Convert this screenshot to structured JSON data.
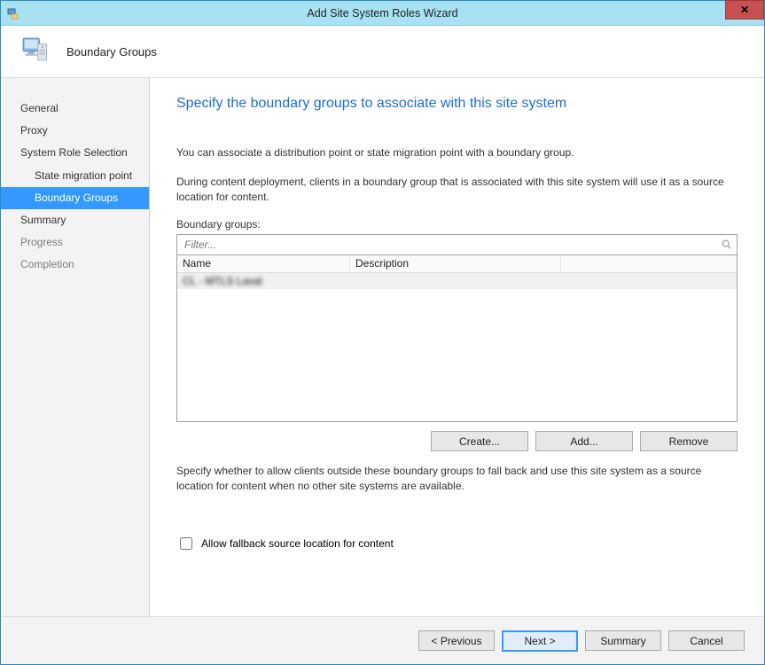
{
  "window": {
    "title": "Add Site System Roles Wizard"
  },
  "banner": {
    "title": "Boundary Groups"
  },
  "nav": {
    "items": [
      {
        "label": "General",
        "indent": false,
        "selected": false,
        "disabled": false
      },
      {
        "label": "Proxy",
        "indent": false,
        "selected": false,
        "disabled": false
      },
      {
        "label": "System Role Selection",
        "indent": false,
        "selected": false,
        "disabled": false
      },
      {
        "label": "State migration point",
        "indent": true,
        "selected": false,
        "disabled": false
      },
      {
        "label": "Boundary Groups",
        "indent": true,
        "selected": true,
        "disabled": false
      },
      {
        "label": "Summary",
        "indent": false,
        "selected": false,
        "disabled": false
      },
      {
        "label": "Progress",
        "indent": false,
        "selected": false,
        "disabled": true
      },
      {
        "label": "Completion",
        "indent": false,
        "selected": false,
        "disabled": true
      }
    ]
  },
  "content": {
    "heading": "Specify the boundary groups to associate with this site system",
    "para1": "You can associate a distribution point or state migration point with a boundary group.",
    "para2": "During content deployment, clients in a boundary group that is associated with this site system will use it as a source location for content.",
    "groups_label": "Boundary groups:",
    "filter_placeholder": "Filter...",
    "columns": {
      "name": "Name",
      "description": "Description"
    },
    "rows": [
      {
        "name": "CL - MTLS Laval",
        "description": ""
      }
    ],
    "buttons": {
      "create": "Create...",
      "add": "Add...",
      "remove": "Remove"
    },
    "para3": "Specify whether to allow clients outside these boundary groups to fall back and use this site system as a source location for content when no other site systems are available.",
    "fallback_label": "Allow fallback source location for content",
    "fallback_checked": false
  },
  "footer": {
    "previous": "< Previous",
    "next": "Next >",
    "summary": "Summary",
    "cancel": "Cancel"
  }
}
